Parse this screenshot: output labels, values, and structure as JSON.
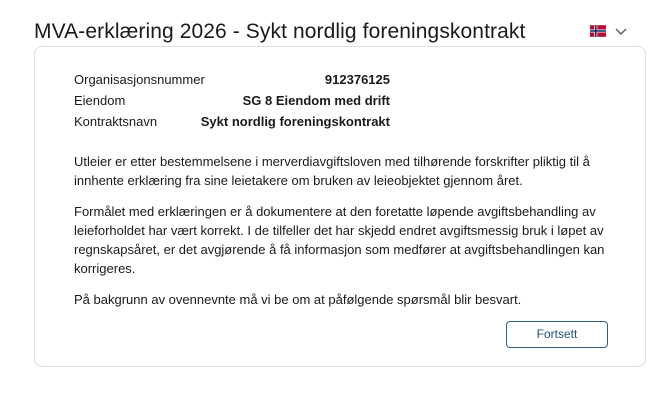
{
  "header": {
    "title": "MVA-erklæring 2026 - Sykt nordlig foreningskontrakt",
    "language_flag_icon": "norway-flag-icon",
    "chevron_icon": "chevron-down-icon"
  },
  "info": {
    "rows": [
      {
        "label": "Organisasjonsnummer",
        "value": "912376125"
      },
      {
        "label": "Eiendom",
        "value": "SG 8 Eiendom med drift"
      },
      {
        "label": "Kontraktsnavn",
        "value": "Sykt nordlig foreningskontrakt"
      }
    ]
  },
  "body": {
    "paragraph1": "Utleier er etter bestemmelsene i merverdiavgiftsloven med tilhørende forskrifter pliktig til å innhente erklæring fra sine leietakere om bruken av leieobjektet gjennom året.",
    "paragraph2": "Formålet med erklæringen er å dokumentere at den foretatte løpende avgiftsbehandling av leieforholdet har vært korrekt. I de tilfeller det har skjedd endret avgiftsmessig bruk i løpet av regnskapsåret, er det avgjørende å få informasjon som medfører at avgiftsbehandlingen kan korrigeres.",
    "paragraph3": "På bakgrunn av ovennevnte må vi be om at påfølgende spørsmål blir besvart."
  },
  "actions": {
    "continue_label": "Fortsett"
  },
  "colors": {
    "accent": "#1f4e79",
    "button_border": "#2e5d8a",
    "card_border": "#dcdfe3",
    "flag_red": "#ba0c2f",
    "flag_blue": "#00205b"
  }
}
